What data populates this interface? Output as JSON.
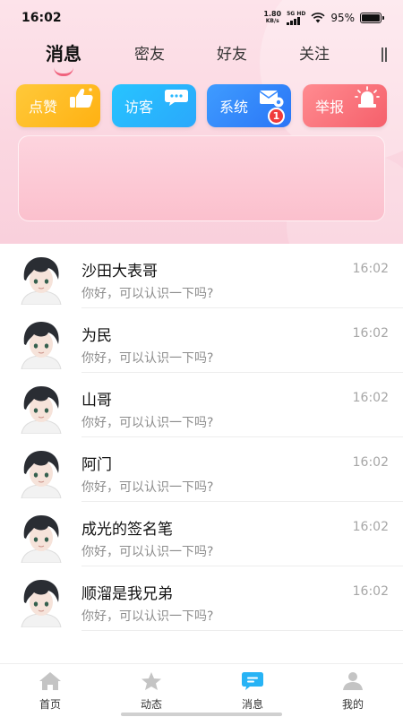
{
  "status_bar": {
    "time": "16:02",
    "net_speed": "1.80",
    "net_unit": "KB/s",
    "signal_tag": "5G HD",
    "battery": "95%"
  },
  "tabs": [
    {
      "label": "消息",
      "active": true
    },
    {
      "label": "密友",
      "active": false
    },
    {
      "label": "好友",
      "active": false
    },
    {
      "label": "关注",
      "active": false
    }
  ],
  "categories": {
    "like": {
      "label": "点赞",
      "icon": "thumbs-up-icon"
    },
    "visit": {
      "label": "访客",
      "icon": "chat-bubble-icon"
    },
    "system": {
      "label": "系统",
      "icon": "mail-gear-icon",
      "badge": "1"
    },
    "report": {
      "label": "举报",
      "icon": "siren-icon"
    }
  },
  "messages": [
    {
      "name": "沙田大表哥",
      "preview": "你好，可以认识一下吗?",
      "time": "16:02"
    },
    {
      "name": "为民",
      "preview": "你好，可以认识一下吗?",
      "time": "16:02"
    },
    {
      "name": "山哥",
      "preview": "你好，可以认识一下吗?",
      "time": "16:02"
    },
    {
      "name": "阿门",
      "preview": "你好，可以认识一下吗?",
      "time": "16:02"
    },
    {
      "name": "成光的签名笔",
      "preview": "你好，可以认识一下吗?",
      "time": "16:02"
    },
    {
      "name": "顺溜是我兄弟",
      "preview": "你好，可以认识一下吗?",
      "time": "16:02"
    }
  ],
  "bottom_nav": [
    {
      "label": "首页",
      "icon": "home-icon",
      "active": false
    },
    {
      "label": "动态",
      "icon": "star-icon",
      "active": false
    },
    {
      "label": "消息",
      "icon": "message-icon",
      "active": true
    },
    {
      "label": "我的",
      "icon": "profile-icon",
      "active": false
    }
  ],
  "colors": {
    "accent": "#f0637e",
    "active_nav": "#27b3f5",
    "inactive_nav": "#c4c4c4",
    "like": "#ffc93a",
    "visit": "#27c4ff",
    "system": "#3f9cff",
    "report": "#f5606b"
  }
}
